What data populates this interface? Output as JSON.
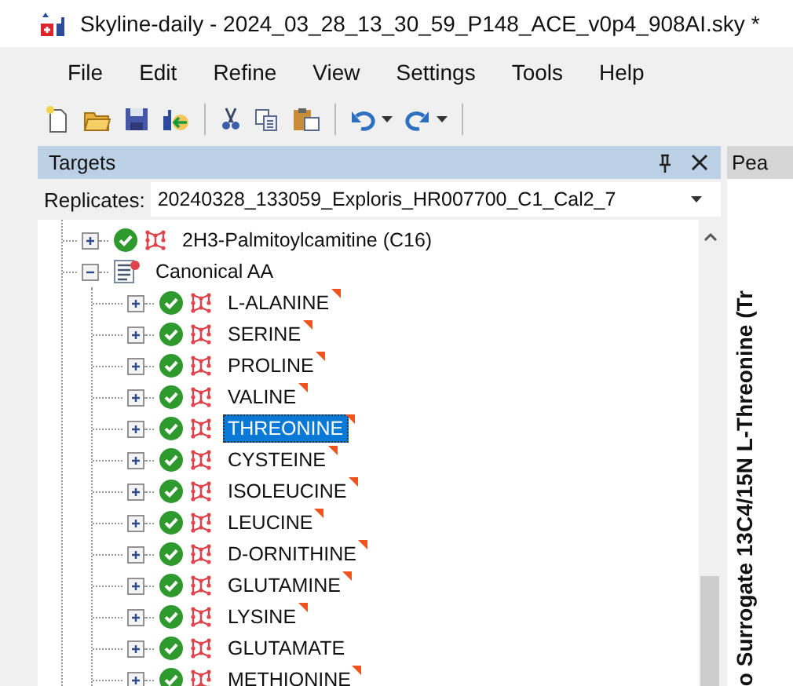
{
  "window": {
    "title": "Skyline-daily - 2024_03_28_13_30_59_P148_ACE_v0p4_908AI.sky *"
  },
  "menu": [
    "File",
    "Edit",
    "Refine",
    "View",
    "Settings",
    "Tools",
    "Help"
  ],
  "toolbar": [
    {
      "kind": "new"
    },
    {
      "kind": "open"
    },
    {
      "kind": "save"
    },
    {
      "kind": "import"
    },
    {
      "kind": "separator"
    },
    {
      "kind": "cut"
    },
    {
      "kind": "copy"
    },
    {
      "kind": "paste"
    },
    {
      "kind": "separator"
    },
    {
      "kind": "undo"
    },
    {
      "kind": "dropdown"
    },
    {
      "kind": "redo"
    },
    {
      "kind": "dropdown"
    },
    {
      "kind": "separator"
    }
  ],
  "targets_panel": {
    "title": "Targets",
    "replicates_label": "Replicates:",
    "replicate": "20240328_133059_Exploris_HR007700_C1_Cal2_7",
    "tree": [
      {
        "label": "2H3-Palmitoylcamitine (C16)",
        "kind": "molecule",
        "expanded": false,
        "selected": false,
        "note": false
      },
      {
        "label": "Canonical AA",
        "kind": "list",
        "expanded": true,
        "selected": false,
        "note": false,
        "children": [
          {
            "label": "L-ALANINE",
            "kind": "molecule",
            "expanded": false,
            "selected": false,
            "note": true
          },
          {
            "label": "SERINE",
            "kind": "molecule",
            "expanded": false,
            "selected": false,
            "note": true
          },
          {
            "label": "PROLINE",
            "kind": "molecule",
            "expanded": false,
            "selected": false,
            "note": true
          },
          {
            "label": "VALINE",
            "kind": "molecule",
            "expanded": false,
            "selected": false,
            "note": true
          },
          {
            "label": "THREONINE",
            "kind": "molecule",
            "expanded": false,
            "selected": true,
            "note": true
          },
          {
            "label": "CYSTEINE",
            "kind": "molecule",
            "expanded": false,
            "selected": false,
            "note": true
          },
          {
            "label": "ISOLEUCINE",
            "kind": "molecule",
            "expanded": false,
            "selected": false,
            "note": true
          },
          {
            "label": "LEUCINE",
            "kind": "molecule",
            "expanded": false,
            "selected": false,
            "note": true
          },
          {
            "label": "D-ORNITHINE",
            "kind": "molecule",
            "expanded": false,
            "selected": false,
            "note": true
          },
          {
            "label": "GLUTAMINE",
            "kind": "molecule",
            "expanded": false,
            "selected": false,
            "note": true
          },
          {
            "label": "LYSINE",
            "kind": "molecule",
            "expanded": false,
            "selected": false,
            "note": true
          },
          {
            "label": "GLUTAMATE",
            "kind": "molecule",
            "expanded": false,
            "selected": false,
            "note": false
          },
          {
            "label": "METHIONINE",
            "kind": "molecule",
            "expanded": false,
            "selected": false,
            "note": true
          }
        ]
      }
    ]
  },
  "side_panel": {
    "tab": "Pea",
    "vertical_label": "o Surrogate 13C4/15N L-Threonine (Tr"
  }
}
